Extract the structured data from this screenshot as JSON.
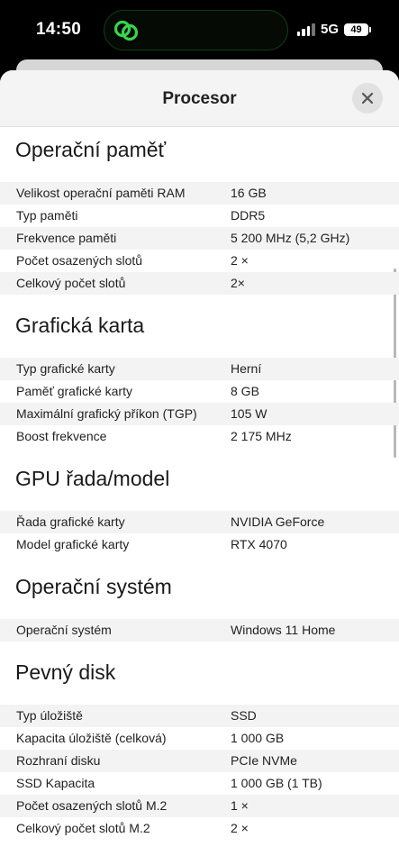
{
  "status_bar": {
    "time": "14:50",
    "network": "5G",
    "battery": "49",
    "island_app_icon": "link-rings-icon"
  },
  "sheet": {
    "title": "Procesor",
    "close_icon": "close-icon"
  },
  "sections": [
    {
      "title": "Operační paměť",
      "rows": [
        {
          "label": "Velikost operační paměti RAM",
          "value": "16 GB"
        },
        {
          "label": "Typ paměti",
          "value": "DDR5"
        },
        {
          "label": "Frekvence paměti",
          "value": "5 200 MHz (5,2 GHz)"
        },
        {
          "label": "Počet osazených slotů",
          "value": "2 ×"
        },
        {
          "label": "Celkový počet slotů",
          "value": "2×"
        }
      ]
    },
    {
      "title": "Grafická karta",
      "rows": [
        {
          "label": "Typ grafické karty",
          "value": "Herní"
        },
        {
          "label": "Paměť grafické karty",
          "value": "8 GB"
        },
        {
          "label": "Maximální grafický příkon (TGP)",
          "value": "105 W"
        },
        {
          "label": "Boost frekvence",
          "value": "2 175 MHz"
        }
      ]
    },
    {
      "title": "GPU řada/model",
      "rows": [
        {
          "label": "Řada grafické karty",
          "value": "NVIDIA GeForce"
        },
        {
          "label": "Model grafické karty",
          "value": "RTX 4070"
        }
      ]
    },
    {
      "title": "Operační systém",
      "rows": [
        {
          "label": "Operační systém",
          "value": "Windows 11 Home"
        }
      ]
    },
    {
      "title": "Pevný disk",
      "rows": [
        {
          "label": "Typ úložiště",
          "value": "SSD"
        },
        {
          "label": "Kapacita úložiště (celková)",
          "value": "1 000 GB"
        },
        {
          "label": "Rozhraní disku",
          "value": "PCIe NVMe"
        },
        {
          "label": "SSD Kapacita",
          "value": "1 000 GB (1 TB)"
        },
        {
          "label": "Počet osazených slotů M.2",
          "value": "1 ×"
        },
        {
          "label": "Celkový počet slotů M.2",
          "value": "2 ×"
        }
      ]
    }
  ]
}
